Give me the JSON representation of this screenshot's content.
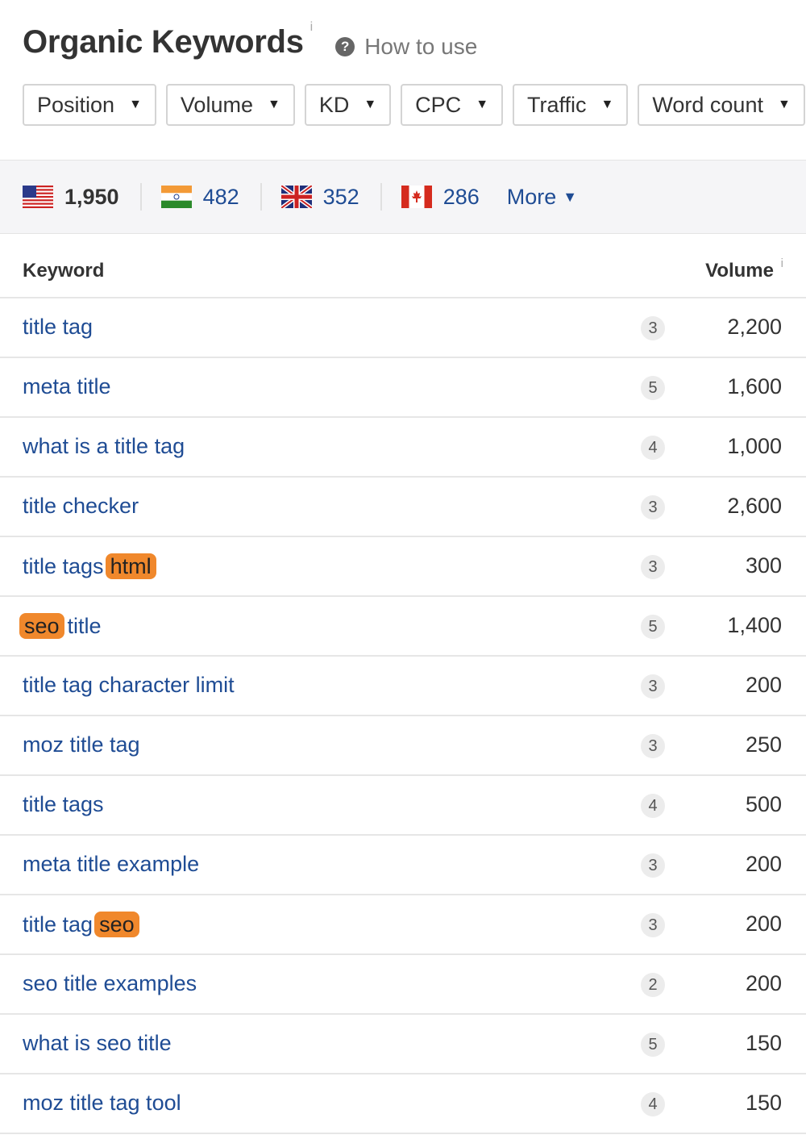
{
  "header": {
    "title": "Organic Keywords",
    "info_mark": "i",
    "how_to_use": "How to use",
    "help_glyph": "?"
  },
  "filters": [
    {
      "label": "Position"
    },
    {
      "label": "Volume"
    },
    {
      "label": "KD"
    },
    {
      "label": "CPC"
    },
    {
      "label": "Traffic"
    },
    {
      "label": "Word count"
    }
  ],
  "countries": [
    {
      "flag": "us-flag-icon",
      "count": "1,950"
    },
    {
      "flag": "india-flag-icon",
      "count": "482"
    },
    {
      "flag": "uk-flag-icon",
      "count": "352"
    },
    {
      "flag": "canada-flag-icon",
      "count": "286"
    }
  ],
  "more_label": "More",
  "table": {
    "columns": {
      "keyword": "Keyword",
      "volume": "Volume",
      "volume_info": "i"
    },
    "rows": [
      {
        "keyword": "title tag",
        "kd": "3",
        "volume": "2,200"
      },
      {
        "keyword": "meta title",
        "kd": "5",
        "volume": "1,600"
      },
      {
        "keyword": "what is a title tag",
        "kd": "4",
        "volume": "1,000"
      },
      {
        "keyword": "title checker",
        "kd": "3",
        "volume": "2,600"
      },
      {
        "keyword": "title tags",
        "highlight_after": "html",
        "kd": "3",
        "volume": "300"
      },
      {
        "highlight_before": "seo",
        "keyword": "title",
        "kd": "5",
        "volume": "1,400"
      },
      {
        "keyword": "title tag character limit",
        "kd": "3",
        "volume": "200"
      },
      {
        "keyword": "moz title tag",
        "kd": "3",
        "volume": "250"
      },
      {
        "keyword": "title tags",
        "kd": "4",
        "volume": "500"
      },
      {
        "keyword": "meta title example",
        "kd": "3",
        "volume": "200"
      },
      {
        "keyword": "title tag",
        "highlight_after": "seo",
        "kd": "3",
        "volume": "200"
      },
      {
        "keyword": "seo title examples",
        "kd": "2",
        "volume": "200"
      },
      {
        "keyword": "what is seo title",
        "kd": "5",
        "volume": "150"
      },
      {
        "keyword": "moz title tag tool",
        "kd": "4",
        "volume": "150"
      }
    ]
  },
  "colors": {
    "link": "#1f4c94",
    "highlight": "#f0882c",
    "band_bg": "#f5f5f7"
  }
}
